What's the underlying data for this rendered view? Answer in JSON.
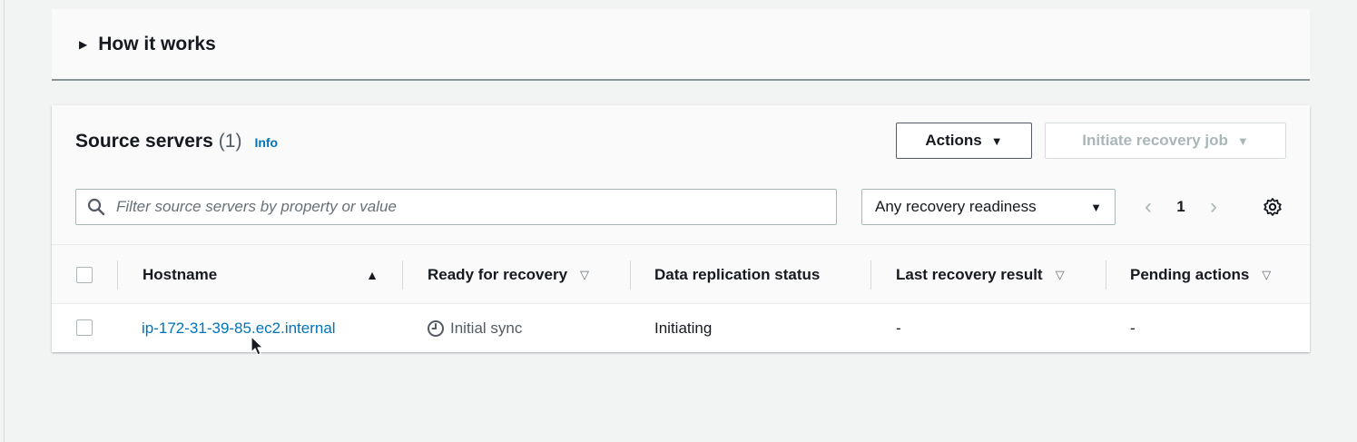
{
  "how_it_works": {
    "title": "How it works"
  },
  "source_servers": {
    "title": "Source servers",
    "count": "(1)",
    "info_label": "Info",
    "actions_label": "Actions",
    "initiate_label": "Initiate recovery job",
    "filter_placeholder": "Filter source servers by property or value",
    "readiness_select": "Any recovery readiness",
    "page_number": "1",
    "columns": [
      "Hostname",
      "Ready for recovery",
      "Data replication status",
      "Last recovery result",
      "Pending actions"
    ],
    "rows": [
      {
        "hostname": "ip-172-31-39-85.ec2.internal",
        "ready": "Initial sync",
        "replication": "Initiating",
        "last_result": "-",
        "pending": "-"
      }
    ]
  },
  "icons": [
    "caret-right-icon",
    "search-icon",
    "chevron-left-icon",
    "chevron-right-icon",
    "gear-icon",
    "clock-icon",
    "sort-asc-icon",
    "sort-desc-icon"
  ],
  "colors": {
    "link": "#0073bb",
    "text": "#16191f",
    "muted": "#545b64",
    "disabled": "#aab7b8",
    "background": "#f2f3f3"
  }
}
